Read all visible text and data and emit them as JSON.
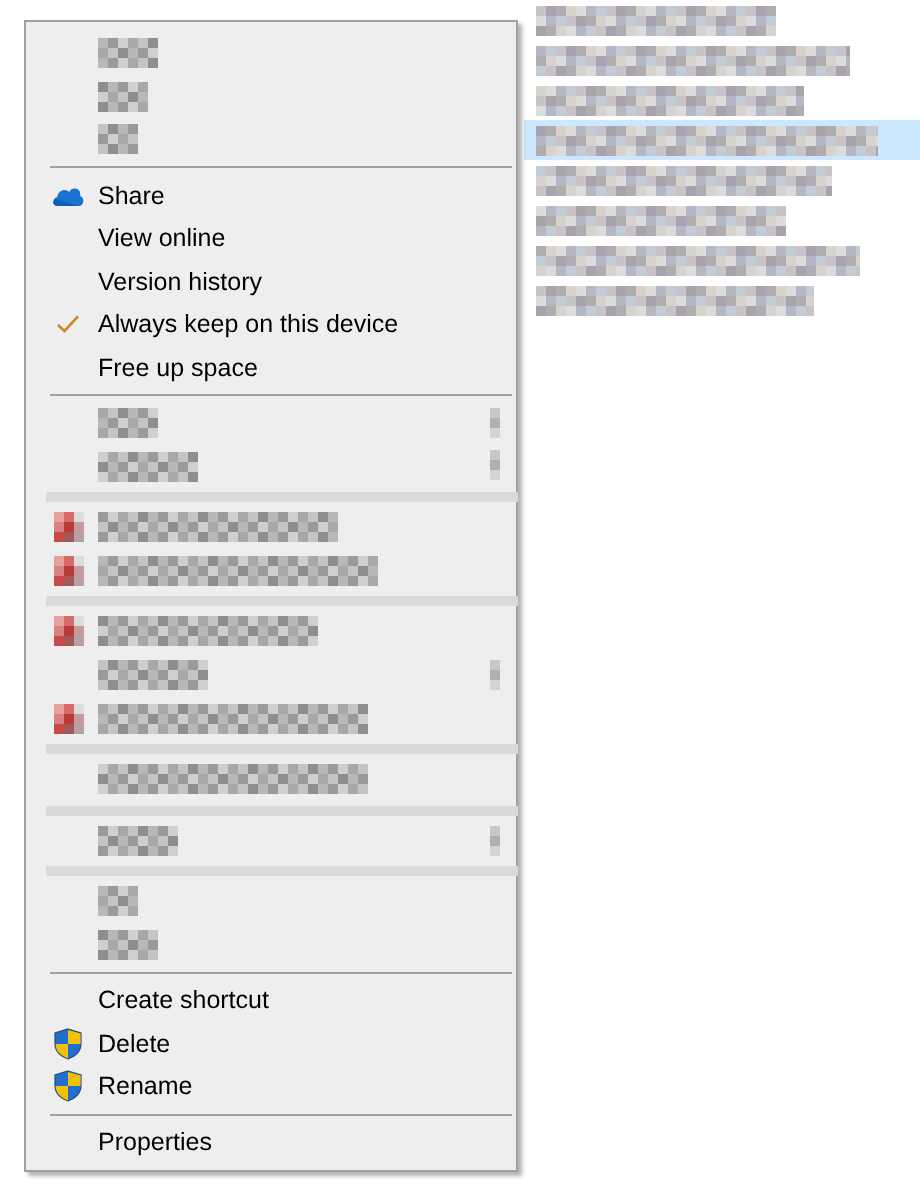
{
  "file_list": {
    "rows": [
      {
        "selected": false
      },
      {
        "selected": false
      },
      {
        "selected": false
      },
      {
        "selected": true
      },
      {
        "selected": false
      },
      {
        "selected": false
      },
      {
        "selected": false
      },
      {
        "selected": false
      }
    ]
  },
  "context_menu": {
    "items": [
      {
        "kind": "redacted"
      },
      {
        "kind": "redacted"
      },
      {
        "kind": "redacted"
      },
      {
        "kind": "separator"
      },
      {
        "kind": "cloud_item",
        "label": "Share",
        "checked": false
      },
      {
        "kind": "item",
        "label": "View online",
        "checked": false
      },
      {
        "kind": "item",
        "label": "Version history",
        "checked": false
      },
      {
        "kind": "item",
        "label": "Always keep on this device",
        "checked": true
      },
      {
        "kind": "item",
        "label": "Free up space",
        "checked": false
      },
      {
        "kind": "separator"
      },
      {
        "kind": "redacted_submenu"
      },
      {
        "kind": "redacted_submenu"
      },
      {
        "kind": "redacted_separator"
      },
      {
        "kind": "redacted_icon"
      },
      {
        "kind": "redacted_icon"
      },
      {
        "kind": "redacted_separator"
      },
      {
        "kind": "redacted_icon"
      },
      {
        "kind": "redacted_submenu"
      },
      {
        "kind": "redacted_icon"
      },
      {
        "kind": "redacted_separator"
      },
      {
        "kind": "redacted"
      },
      {
        "kind": "redacted_separator"
      },
      {
        "kind": "redacted_submenu"
      },
      {
        "kind": "redacted_separator"
      },
      {
        "kind": "redacted"
      },
      {
        "kind": "redacted"
      },
      {
        "kind": "separator"
      },
      {
        "kind": "item",
        "label": "Create shortcut",
        "checked": false
      },
      {
        "kind": "shield_item",
        "label": "Delete",
        "checked": false
      },
      {
        "kind": "shield_item",
        "label": "Rename",
        "checked": false
      },
      {
        "kind": "separator"
      },
      {
        "kind": "item",
        "label": "Properties",
        "checked": false
      }
    ]
  }
}
